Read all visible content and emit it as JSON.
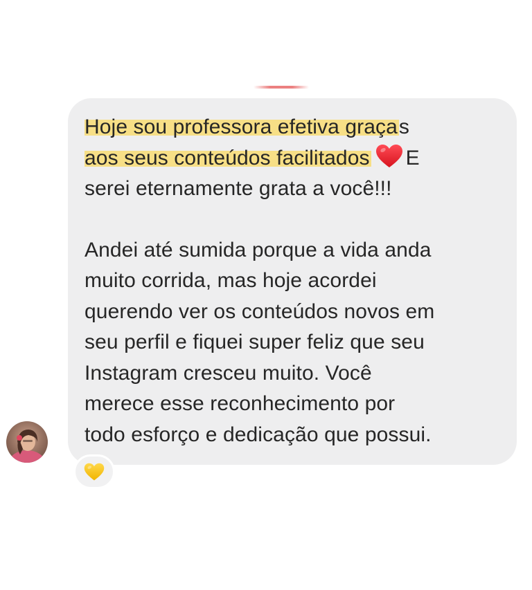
{
  "message": {
    "paragraph1": {
      "line1": "Hoje sou professora efetiva graça",
      "line1_tail": "s",
      "line2": "aos seus conteúdos facilitados",
      "line2_tail": "E",
      "line3": "serei eternamente grata a você!!!"
    },
    "paragraph2": {
      "lines": [
        "Andei até sumida porque a vida anda",
        "muito corrida, mas hoje acordei",
        "querendo ver os conteúdos novos em",
        "seu perfil e fiquei super feliz que seu",
        "Instagram cresceu muito. Você",
        "merece esse reconhecimento por",
        "todo esforço e dedicação que possui."
      ]
    },
    "inline_emoji": "red-heart-icon",
    "highlight_color": "#f7df86",
    "bubble_color": "#eeeeef"
  },
  "reaction": {
    "emoji": "yellow-heart-icon",
    "color": "#f5c518"
  },
  "sender": {
    "avatar": "avatar"
  }
}
